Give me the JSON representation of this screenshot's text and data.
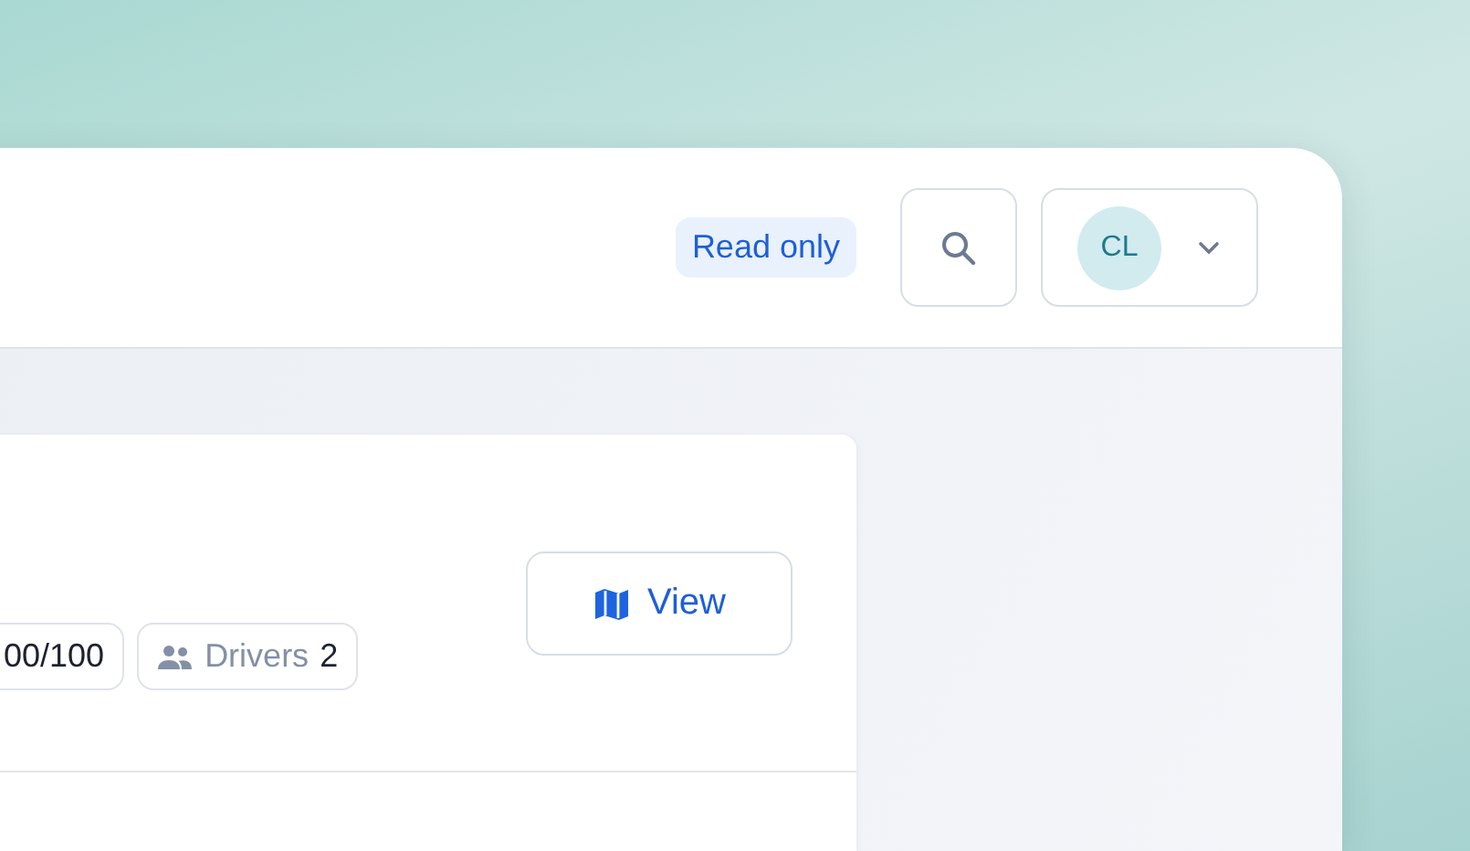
{
  "header": {
    "badge": "Read only",
    "user_menu": {
      "initials": "CL"
    }
  },
  "card": {
    "chips": [
      {
        "kind": "plain",
        "text": "00/100"
      },
      {
        "kind": "people",
        "label": "Drivers",
        "value": "2"
      }
    ],
    "view_button": "View"
  }
}
